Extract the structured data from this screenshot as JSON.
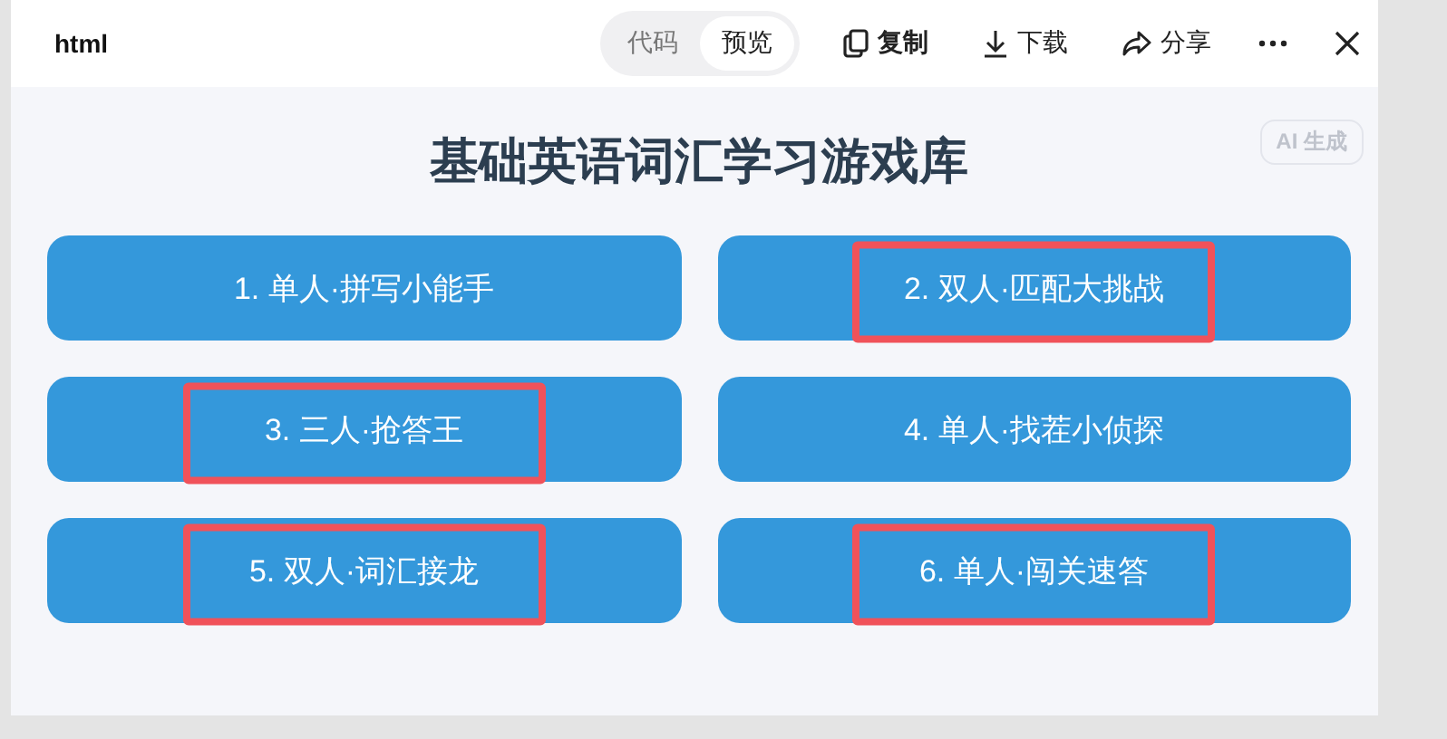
{
  "header": {
    "title": "html",
    "tabs": [
      {
        "label": "代码",
        "selected": false
      },
      {
        "label": "预览",
        "selected": true
      }
    ],
    "actions": [
      {
        "kind": "copy",
        "label": "复制"
      },
      {
        "kind": "download",
        "label": "下载"
      },
      {
        "kind": "share",
        "label": "分享"
      },
      {
        "kind": "more"
      },
      {
        "kind": "close"
      }
    ]
  },
  "page": {
    "title": "基础英语词汇学习游戏库",
    "badge": "AI 生成",
    "games": [
      {
        "label": "1. 单人·拼写小能手",
        "highlighted": false
      },
      {
        "label": "2. 双人·匹配大挑战",
        "highlighted": true
      },
      {
        "label": "3. 三人·抢答王",
        "highlighted": true
      },
      {
        "label": "4. 单人·找茬小侦探",
        "highlighted": false
      },
      {
        "label": "5. 双人·词汇接龙",
        "highlighted": true
      },
      {
        "label": "6. 单人·闯关速答",
        "highlighted": true
      }
    ]
  }
}
